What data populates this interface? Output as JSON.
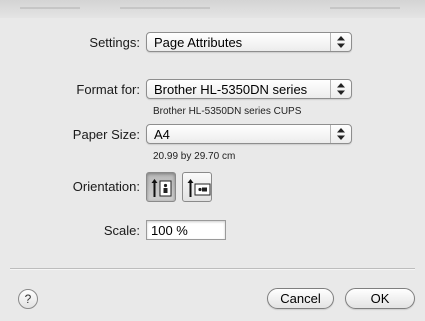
{
  "settings": {
    "label": "Settings:",
    "value": "Page Attributes"
  },
  "format_for": {
    "label": "Format for:",
    "value": "Brother HL-5350DN series",
    "detail": "Brother HL-5350DN series CUPS"
  },
  "paper_size": {
    "label": "Paper Size:",
    "value": "A4",
    "detail": "20.99 by 29.70 cm"
  },
  "orientation": {
    "label": "Orientation:",
    "selected": "portrait",
    "options": [
      "portrait",
      "landscape"
    ]
  },
  "scale": {
    "label": "Scale:",
    "value": "100 %"
  },
  "buttons": {
    "help": "?",
    "cancel": "Cancel",
    "ok": "OK"
  },
  "icons": {
    "popup_arrows": "up-down-arrows-icon",
    "portrait": "portrait-orientation-icon",
    "landscape": "landscape-orientation-icon",
    "help": "help-icon"
  },
  "colors": {
    "background": "#e9e9e9",
    "divider": "#bdbdbd",
    "input_background": "#ffffff"
  }
}
